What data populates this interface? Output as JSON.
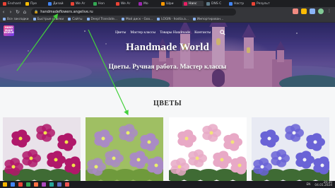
{
  "browser": {
    "tabs": [
      {
        "label": "Enchant",
        "color": "#ea4335"
      },
      {
        "label": "Пре",
        "color": "#fbbc04"
      },
      {
        "label": "Дизай",
        "color": "#4285f4"
      },
      {
        "label": "We Ar",
        "color": "#ea4335"
      },
      {
        "label": "Hon",
        "color": "#34a853"
      },
      {
        "label": "We Ar",
        "color": "#ea4335"
      },
      {
        "label": "Мо",
        "color": "#9c27b0"
      },
      {
        "label": "Шри",
        "color": "#ff9800"
      },
      {
        "label": "Hanc",
        "color": "#e91e63",
        "active": true
      },
      {
        "label": "DNS C",
        "color": "#607d8b"
      },
      {
        "label": "Настр",
        "color": "#4285f4"
      },
      {
        "label": "Результ",
        "color": "#ea4335"
      }
    ],
    "url": "handmadeflowers.angelive.ru",
    "bookmarks": [
      "Все закладки",
      "Быстрые ссылки",
      "Сайты",
      "Deepl Translate...",
      "Мой диск - Goo...",
      "LOGIN · hostia.a...",
      "Импортирован..."
    ],
    "colors": {
      "chrome": "#35363a",
      "omnibox": "#202124"
    }
  },
  "site": {
    "logo_text": "HAND MADE WORLD",
    "menu": [
      "Цветы",
      "Мастер классы",
      "Товары Handmade",
      "Контакты"
    ],
    "search_icon": "magnifier-icon",
    "title": "Handmade World",
    "tagline": "Цветы. Ручная работа. Мастер классы",
    "section_title": "ЦВЕТЫ",
    "cards": [
      {
        "name": "magenta-violets",
        "petal": "#b0186a",
        "center": "#f2e24a",
        "bg": "#e9e2ea"
      },
      {
        "name": "lilac-violets-green-frills",
        "petal": "#a98bc4",
        "center": "#e9f06a",
        "bg": "#9fbf63"
      },
      {
        "name": "pink-violets",
        "petal": "#e8a9c6",
        "center": "#f3e27a",
        "bg": "#ffffff"
      },
      {
        "name": "blue-bellflowers",
        "petal": "#6a63d6",
        "center": "#f1f1f6",
        "bg": "#e8eaf3"
      }
    ],
    "colors": {
      "accent": "#ffffff",
      "background": "#f6f7f8",
      "heading": "#2b2b2b"
    }
  },
  "taskbar": {
    "icons": [
      "#f4b400",
      "#4285f4",
      "#ea4335",
      "#34a853",
      "#ff7043",
      "#ab47bc",
      "#26a69a",
      "#5c6bc0",
      "#ef5350"
    ],
    "time": "20:30",
    "date": "04.01.2024",
    "lang": "EN"
  }
}
